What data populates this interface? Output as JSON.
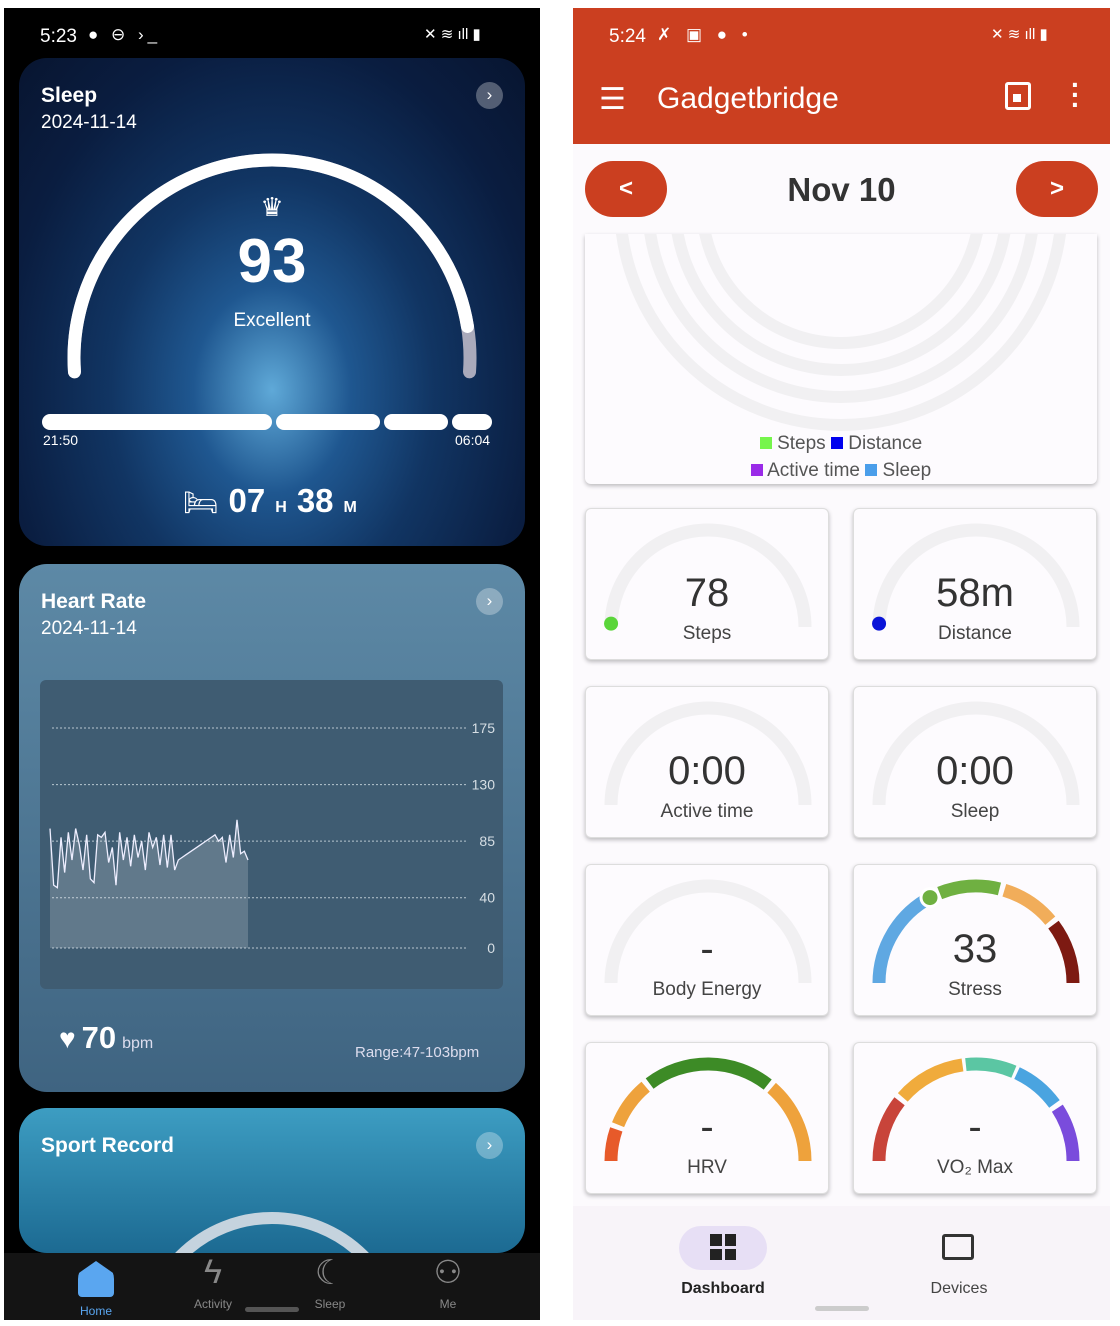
{
  "left_phone": {
    "status": {
      "time": "5:23",
      "icons": [
        "chat-bubble-icon",
        "vpn-icon",
        "terminal-icon"
      ],
      "right_icons": [
        "mute-icon",
        "wifi-icon",
        "signal-icon",
        "battery-icon"
      ]
    },
    "sleep": {
      "title": "Sleep",
      "date": "2024-11-14",
      "score": "93",
      "score_fraction": 0.93,
      "rating": "Excellent",
      "start": "21:50",
      "end": "06:04",
      "hours": "07",
      "h_unit": "H",
      "minutes": "38",
      "m_unit": "M"
    },
    "heart_rate": {
      "title": "Heart Rate",
      "date": "2024-11-14",
      "current": "70",
      "unit": "bpm",
      "range": "Range:47-103bpm"
    },
    "sport": {
      "title": "Sport Record"
    },
    "nav": [
      {
        "label": "Home",
        "active": true
      },
      {
        "label": "Activity"
      },
      {
        "label": "Sleep"
      },
      {
        "label": "Me"
      }
    ]
  },
  "chart_data": {
    "type": "area",
    "yticks": [
      175,
      130,
      85,
      40,
      0
    ],
    "ylim": [
      0,
      175
    ],
    "grid": true,
    "values": [
      95,
      50,
      48,
      88,
      60,
      92,
      70,
      95,
      82,
      62,
      90,
      55,
      52,
      90,
      88,
      92,
      68,
      80,
      50,
      92,
      70,
      88,
      65,
      90,
      72,
      85,
      62,
      92,
      80,
      88,
      66,
      90,
      64,
      90,
      62,
      70,
      72,
      74,
      76,
      78,
      80,
      82,
      84,
      86,
      88,
      90,
      85,
      88,
      68,
      90,
      72,
      102,
      75,
      77,
      70
    ]
  },
  "right_phone": {
    "status": {
      "time": "5:24",
      "icons": [
        "no-location-icon",
        "image-icon",
        "chat-bubble-icon",
        "dot-icon"
      ],
      "right_icons": [
        "mute-icon",
        "wifi-icon",
        "signal-icon",
        "battery-icon"
      ]
    },
    "app_title": "Gadgetbridge",
    "date": "Nov 10",
    "prev": "<",
    "next": ">",
    "legend": [
      {
        "label": "Steps",
        "color": "#76f54c"
      },
      {
        "label": "Distance",
        "color": "#0000ee"
      },
      {
        "label": "Active time",
        "color": "#9a2be8"
      },
      {
        "label": "Sleep",
        "color": "#4a9eea"
      }
    ],
    "gauges": [
      {
        "value": "78",
        "label": "Steps",
        "marker": "#5ad53a"
      },
      {
        "value": "58m",
        "label": "Distance",
        "marker": "#0a14d8"
      },
      {
        "value": "0:00",
        "label": "Active time"
      },
      {
        "value": "0:00",
        "label": "Sleep"
      },
      {
        "value": "-",
        "label": "Body Energy"
      },
      {
        "value": "33",
        "label": "Stress",
        "fraction": 0.33
      },
      {
        "value": "-",
        "label": "HRV"
      },
      {
        "value": "-",
        "label": "VO₂ Max"
      }
    ],
    "nav": [
      {
        "label": "Dashboard",
        "active": true
      },
      {
        "label": "Devices"
      }
    ]
  }
}
